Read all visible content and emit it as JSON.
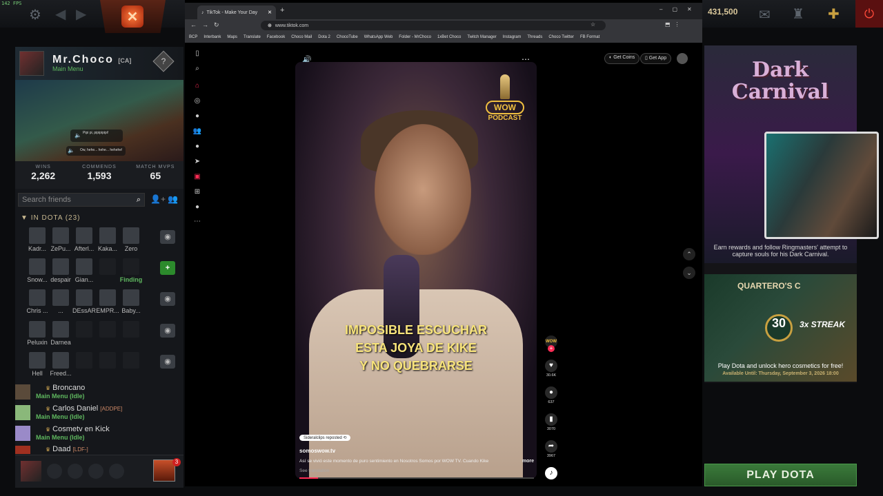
{
  "fps": "142 FPS",
  "gold": "431,500",
  "profile": {
    "name": "Mr.Choco",
    "tag": "[CA]",
    "status": "Main Menu",
    "bubble1": "Pipi pi, pipipipipi!",
    "bubble2": "Ow, hehe... hehe... hehehe!",
    "stats": [
      {
        "label": "WINS",
        "value": "2,262"
      },
      {
        "label": "COMMENDS",
        "value": "1,593"
      },
      {
        "label": "MATCH MVPS",
        "value": "65"
      }
    ]
  },
  "search_placeholder": "Search friends",
  "in_dota_label": "IN DOTA (23)",
  "grid": [
    [
      "Kadr...",
      "ZePu...",
      "Afterl...",
      "Kaka...",
      "Zero"
    ],
    [
      "Snow...",
      "despair",
      "Gian...",
      "",
      "Finding"
    ],
    [
      "Chris ...",
      "...",
      "DEssAR",
      "EMPR...",
      "Baby..."
    ],
    [
      "Peluxin",
      "Darnea",
      "",
      "",
      ""
    ],
    [
      "Hell",
      "Freed...",
      "",
      "",
      ""
    ]
  ],
  "friends": [
    {
      "name": "Broncano",
      "tag": "",
      "status": ""
    },
    {
      "name": "Carlos Daniel",
      "tag": "[ADDPE]",
      "status": "Main Menu (Idle)"
    },
    {
      "name": "Cosmetv en Kick",
      "tag": "",
      "status": "Main Menu (Idle)"
    },
    {
      "name": "Daad",
      "tag": "[LDF-]",
      "status": "Main Menu (Idle)"
    }
  ],
  "broncano_status": "Main Menu (Idle)",
  "notif_count": "3",
  "browser": {
    "tab_title": "TikTok - Make Your Day",
    "url": "www.tiktok.com",
    "bookmarks": [
      "BCP",
      "Interbank",
      "Maps",
      "Translate",
      "Facebook",
      "Choco Mail",
      "Dota 2",
      "ChocoTube",
      "WhatsApp Web",
      "Folder - MrChoco",
      "1xBet Choco",
      "Twitch Manager",
      "Instagram",
      "Threads",
      "Choco Twitter",
      "FB Format"
    ]
  },
  "tiktok": {
    "get_coins": "Get Coins",
    "get_app": "Get App",
    "caption": [
      "IMPOSIBLE ESCUCHAR",
      "ESTA JOYA DE KIKE",
      "Y NO QUEBRARSE"
    ],
    "wow": "WOW",
    "podcast": "PODCAST",
    "repost": "Sideralclips reposted",
    "account": "somoswow.tv",
    "description": "Así se vivió este momento de puro sentimiento en Nosotros Somos por WOW TV. Cuando Kike",
    "more": "more",
    "see_translation": "See translation",
    "likes": "30.6K",
    "comments": "637",
    "saves": "3070",
    "shares": "3967",
    "progress": 0.08
  },
  "right": {
    "event_title": "Dark Carnival",
    "event_text": "Earn rewards and follow Ringmasters' attempt to capture souls for his Dark Carnival.",
    "quartero": "QUARTERO'S C",
    "streak_num": "30",
    "streak": "3x STREAK",
    "promo_text": "Play Dota and unlock hero cosmetics for free!",
    "promo_sub": "Available Until: Thursday, September 3, 2026 18:00",
    "play": "PLAY DOTA"
  }
}
